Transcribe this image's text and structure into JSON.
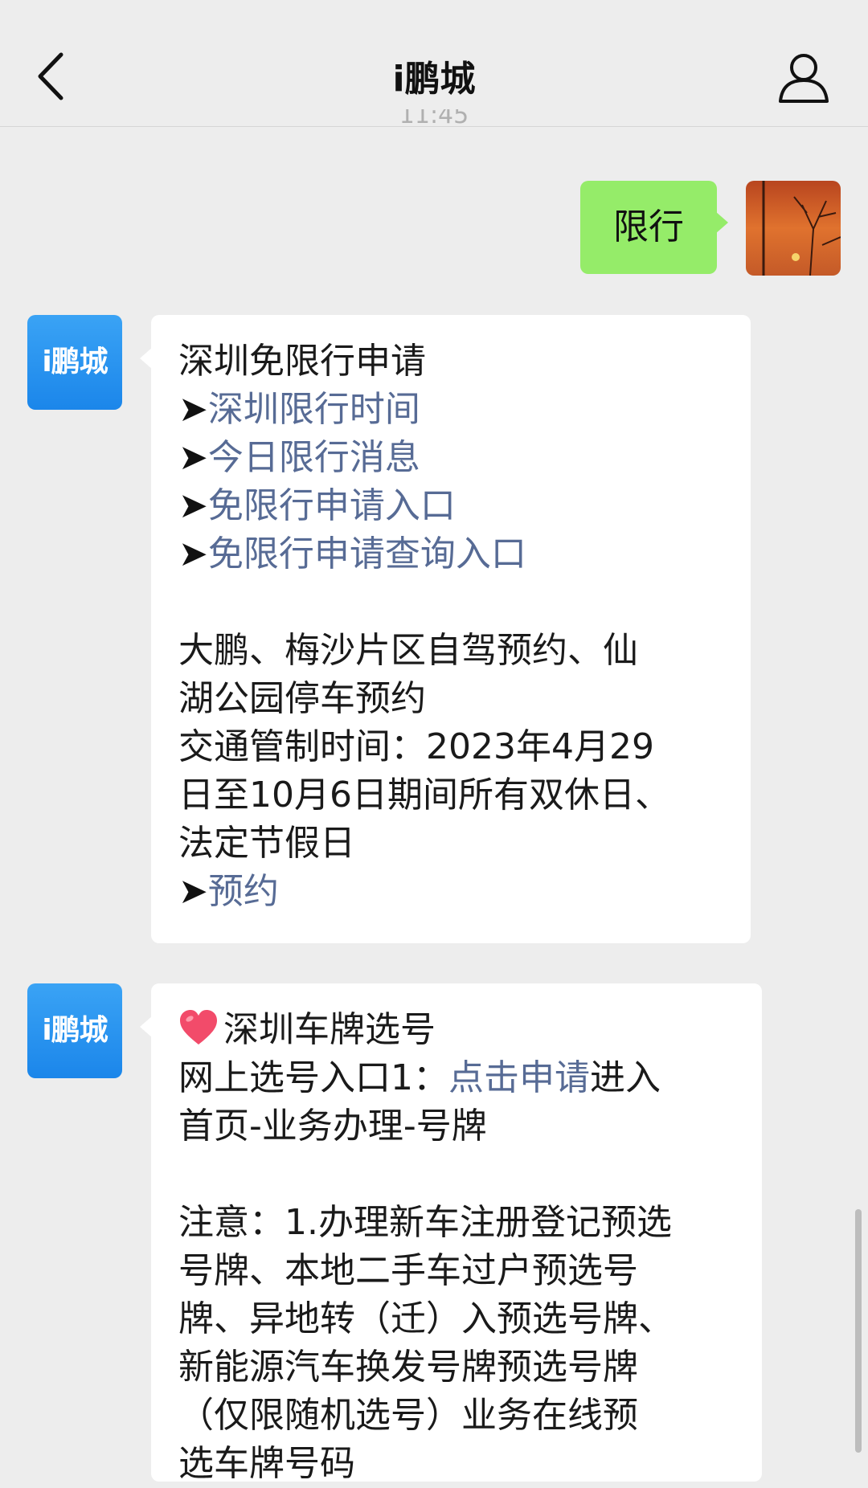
{
  "header": {
    "title": "i鹏城"
  },
  "timestamp_remnant": "11:45",
  "user_message": {
    "text": "限行"
  },
  "bot_avatar": {
    "label": "i鹏城"
  },
  "message1": {
    "heading": "深圳免限行申请",
    "arrow": "➤",
    "links": [
      "深圳限行时间",
      "今日限行消息",
      "免限行申请入口",
      "免限行申请查询入口"
    ],
    "section2_lines": [
      "大鹏、梅沙片区自驾预约、仙",
      "湖公园停车预约",
      "交通管制时间：2023年4月29",
      "日至10月6日期间所有双休日、",
      "法定节假日"
    ],
    "reserve_link": "预约"
  },
  "message2": {
    "heading": "深圳车牌选号",
    "entry_prefix": "网上选号入口1：",
    "entry_link": "点击申请",
    "entry_suffix": "进入",
    "entry_line2": "首页-业务办理-号牌",
    "note_lines": [
      "注意：1.办理新车注册登记预选",
      "号牌、本地二手车过户预选号",
      "牌、异地转（迁）入预选号牌、",
      "新能源汽车换发号牌预选号牌",
      "（仅限随机选号）业务在线预",
      "选车牌号码"
    ]
  },
  "colors": {
    "background": "#ededed",
    "user_bubble": "#95ec69",
    "link": "#576b95",
    "avatar_blue": "#1b86ea"
  }
}
